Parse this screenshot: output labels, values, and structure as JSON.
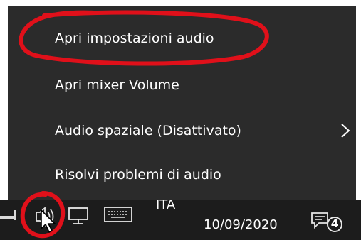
{
  "context_menu": {
    "items": [
      {
        "label": "Apri impostazioni audio"
      },
      {
        "label": "Apri mixer Volume"
      },
      {
        "label": "Audio spaziale (Disattivato)",
        "has_submenu": true
      },
      {
        "label": "Risolvi problemi di audio"
      }
    ]
  },
  "taskbar": {
    "language": "ITA",
    "language_visible_text": "ITA",
    "date": "10/09/2020",
    "notification_count": "4",
    "icons": [
      "network-icon",
      "volume-icon",
      "monitor-icon",
      "keyboard-icon",
      "notification-icon"
    ]
  },
  "colors": {
    "menu_background": "#2b2b2b",
    "taskbar_background": "#1c1c1c",
    "text": "#ffffff",
    "annotation_red": "#e0101a"
  }
}
